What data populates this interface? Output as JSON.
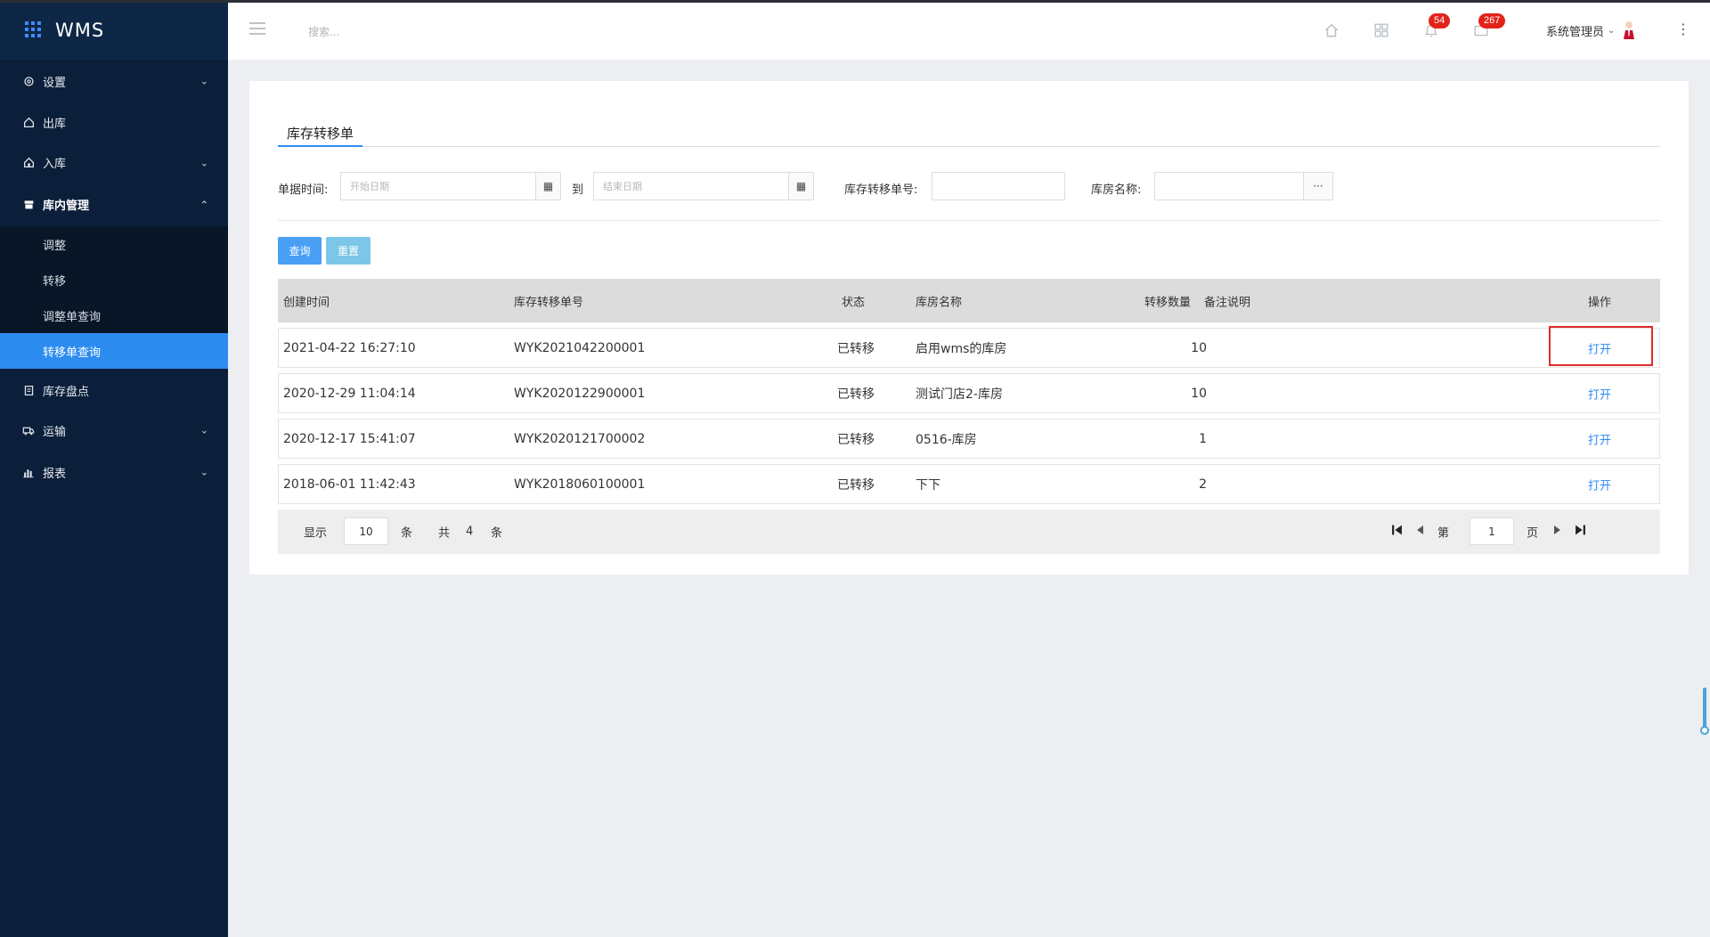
{
  "app": {
    "brand": "WMS"
  },
  "sidebar": {
    "items": [
      {
        "label": "设置",
        "icon": "gear-icon",
        "has_arrow": true,
        "arrow": "⌄"
      },
      {
        "label": "出库",
        "icon": "home-out-icon",
        "has_arrow": false
      },
      {
        "label": "入库",
        "icon": "home-in-icon",
        "has_arrow": true,
        "arrow": "⌄"
      },
      {
        "label": "库内管理",
        "icon": "box-icon",
        "has_arrow": true,
        "arrow": "⌃",
        "open": true
      },
      {
        "label": "库存盘点",
        "icon": "clipboard-icon",
        "has_arrow": false
      },
      {
        "label": "运输",
        "icon": "truck-icon",
        "has_arrow": true,
        "arrow": "⌄"
      },
      {
        "label": "报表",
        "icon": "bar-chart-icon",
        "has_arrow": true,
        "arrow": "⌄"
      }
    ],
    "submenu": [
      {
        "label": "调整"
      },
      {
        "label": "转移"
      },
      {
        "label": "调整单查询"
      },
      {
        "label": "转移单查询",
        "active": true
      }
    ]
  },
  "header": {
    "search_placeholder": "搜索...",
    "badges": {
      "notifications": "54",
      "messages": "267"
    },
    "user_name": "系统管理员"
  },
  "page": {
    "tab_title": "库存转移单",
    "filters": {
      "date_label": "单据时间:",
      "start_placeholder": "开始日期",
      "to_label": "到",
      "end_placeholder": "结束日期",
      "order_no_label": "库存转移单号:",
      "warehouse_label": "库房名称:",
      "more_label": "···"
    },
    "buttons": {
      "query": "查询",
      "reset": "重置"
    }
  },
  "table": {
    "columns": [
      "创建时间",
      "库存转移单号",
      "状态",
      "库房名称",
      "转移数量",
      "备注说明",
      "操作"
    ],
    "rows": [
      {
        "created": "2021-04-22 16:27:10",
        "order_no": "WYK2021042200001",
        "status": "已转移",
        "warehouse": "启用wms的库房",
        "qty": "10",
        "remark": "",
        "action": "打开"
      },
      {
        "created": "2020-12-29 11:04:14",
        "order_no": "WYK2020122900001",
        "status": "已转移",
        "warehouse": "测试门店2-库房",
        "qty": "10",
        "remark": "",
        "action": "打开"
      },
      {
        "created": "2020-12-17 15:41:07",
        "order_no": "WYK2020121700002",
        "status": "已转移",
        "warehouse": "0516-库房",
        "qty": "1",
        "remark": "",
        "action": "打开"
      },
      {
        "created": "2018-06-01 11:42:43",
        "order_no": "WYK2018060100001",
        "status": "已转移",
        "warehouse": "下下",
        "qty": "2",
        "remark": "",
        "action": "打开"
      }
    ]
  },
  "pager": {
    "show_label": "显示",
    "page_size": "10",
    "unit": "条",
    "total_label": "共",
    "total": "4",
    "total_unit": "条",
    "page_prefix": "第",
    "page": "1",
    "page_suffix": "页"
  },
  "colors": {
    "sidebar_bg": "#0c1f3a",
    "accent": "#2d8cf0",
    "badge": "#e2231a",
    "highlight": "#e02b2b"
  }
}
